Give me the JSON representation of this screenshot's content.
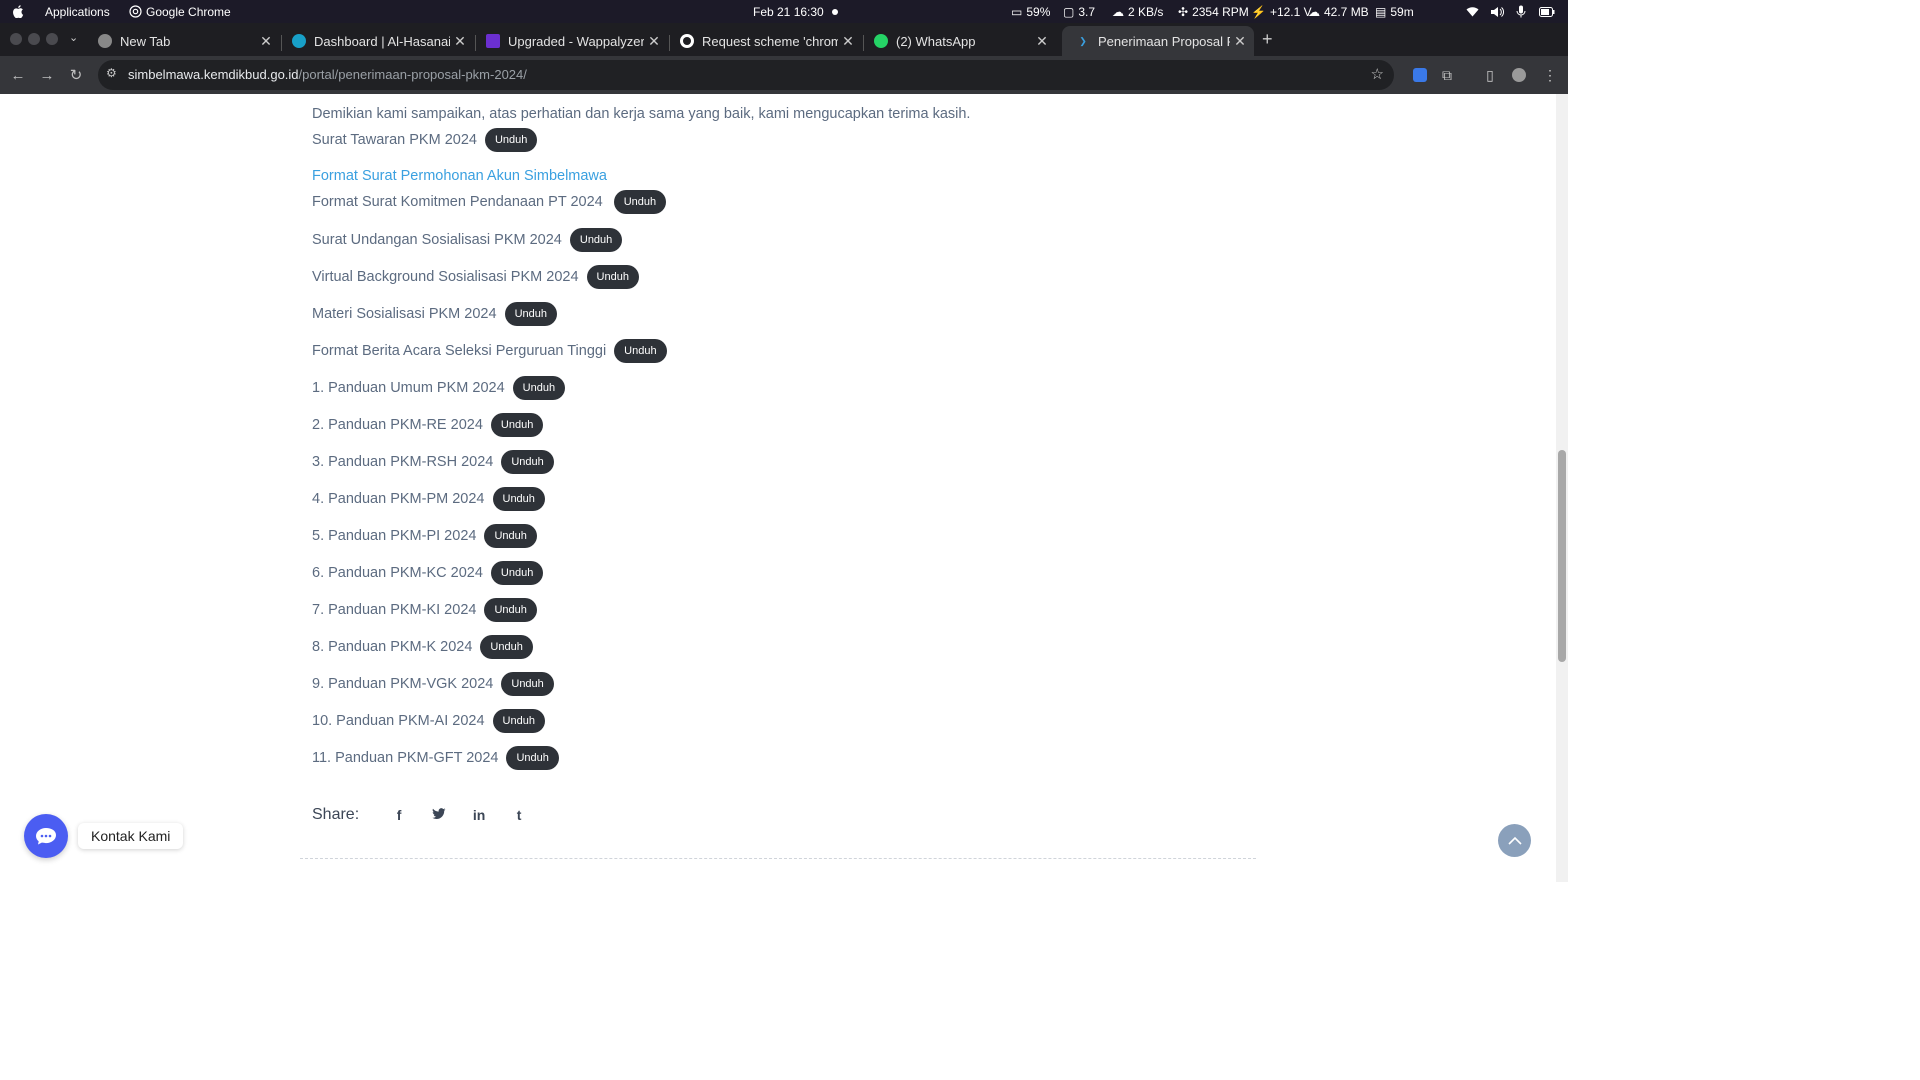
{
  "os_bar": {
    "apps_label": "Applications",
    "active_app": "Google Chrome",
    "datetime": "Feb 21  16:30",
    "battery_pct": "59%",
    "load": "3.7",
    "net_speed": "2 KB/s",
    "fan": "2354 RPM",
    "voltage": "+12.1 V",
    "mem": "42.7 MB",
    "time_left": "59m"
  },
  "tabs": [
    {
      "label": "New Tab",
      "icon": "chrome-icon",
      "active": false
    },
    {
      "label": "Dashboard | Al-Hasanain",
      "icon": "dashboard-icon",
      "active": false
    },
    {
      "label": "Upgraded - Wappalyzer",
      "icon": "wappalyzer-icon",
      "active": false
    },
    {
      "label": "Request scheme 'chrome",
      "icon": "github-icon",
      "active": false
    },
    {
      "label": "(2) WhatsApp",
      "icon": "whatsapp-icon",
      "active": false
    },
    {
      "label": "Penerimaan Proposal PKM",
      "icon": "simbelmawa-icon",
      "active": true
    }
  ],
  "toolbar": {
    "url_host": "simbelmawa.kemdikbud.go.id",
    "url_path": "/portal/penerimaan-proposal-pkm-2024/"
  },
  "content": {
    "intro_text": "Demikian kami sampaikan, atas perhatian dan kerja sama yang baik, kami mengucapkan terima kasih.",
    "link_text": "Format Surat Permohonan Akun Simbelmawa",
    "download_label": "Unduh",
    "documents": [
      {
        "label": "Surat Tawaran PKM 2024"
      },
      {
        "label": "Format Surat Komitmen Pendanaan PT 2024"
      },
      {
        "label": "Surat Undangan Sosialisasi PKM 2024"
      },
      {
        "label": "Virtual Background Sosialisasi PKM 2024"
      },
      {
        "label": "Materi Sosialisasi PKM 2024"
      },
      {
        "label": "Format Berita Acara Seleksi Perguruan Tinggi"
      },
      {
        "label": "1. Panduan Umum PKM 2024"
      },
      {
        "label": "2. Panduan PKM-RE 2024"
      },
      {
        "label": "3. Panduan PKM-RSH 2024"
      },
      {
        "label": "4. Panduan PKM-PM 2024"
      },
      {
        "label": "5. Panduan PKM-PI 2024"
      },
      {
        "label": "6. Panduan PKM-KC 2024"
      },
      {
        "label": "7. Panduan PKM-KI 2024"
      },
      {
        "label": "8. Panduan PKM-K 2024"
      },
      {
        "label": "9. Panduan PKM-VGK 2024"
      },
      {
        "label": "10. Panduan PKM-AI 2024"
      },
      {
        "label": "11. Panduan PKM-GFT 2024"
      }
    ],
    "share_label": "Share:",
    "share_icons": [
      "facebook-icon",
      "twitter-icon",
      "linkedin-icon",
      "tumblr-icon"
    ]
  },
  "widgets": {
    "contact_label": "Kontak Kami"
  }
}
